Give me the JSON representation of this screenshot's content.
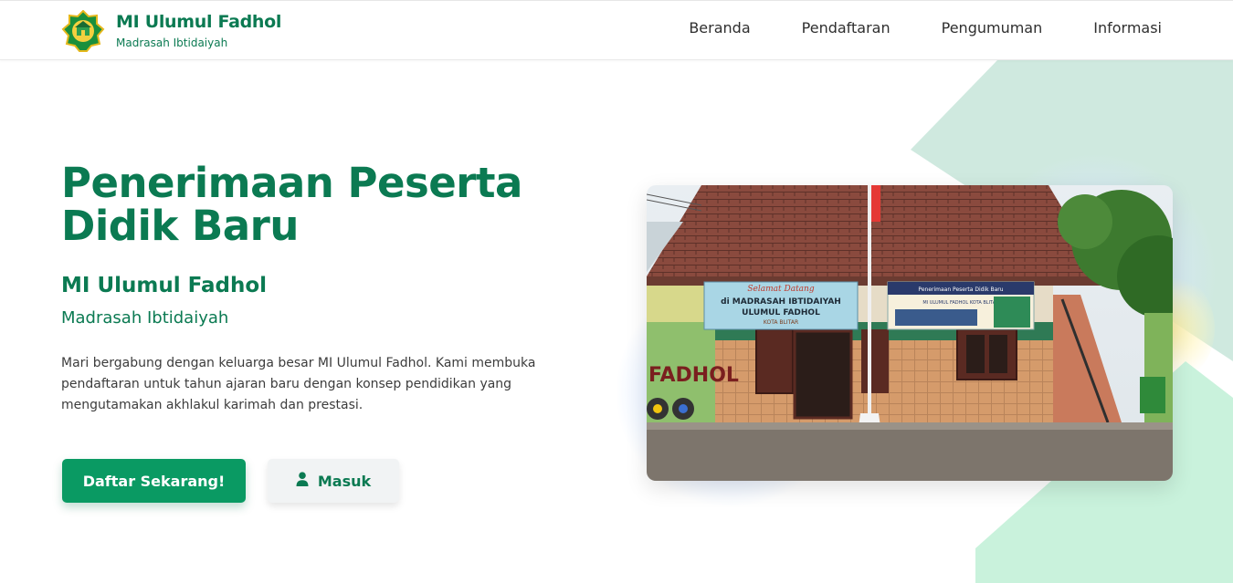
{
  "header": {
    "brand_name": "MI Ulumul Fadhol",
    "brand_sub": "Madrasah Ibtidaiyah",
    "logo_icon": "school-emblem-icon",
    "nav": [
      {
        "label": "Beranda"
      },
      {
        "label": "Pendaftaran"
      },
      {
        "label": "Pengumuman"
      },
      {
        "label": "Informasi"
      }
    ]
  },
  "hero": {
    "title_line1": "Penerimaan Peserta",
    "title_line2": "Didik Baru",
    "school_name": "MI Ulumul Fadhol",
    "school_type": "Madrasah Ibtidaiyah",
    "description": "Mari bergabung dengan keluarga besar MI Ulumul Fadhol. Kami membuka pendaftaran untuk tahun ajaran baru dengan konsep pendidikan yang mengutamakan akhlakul karimah dan prestasi.",
    "primary_button": "Daftar Sekarang!",
    "secondary_button": "Masuk",
    "secondary_icon": "user-icon"
  },
  "photo": {
    "banner_left_line1": "Selamat Datang",
    "banner_left_line2": "di MADRASAH IBTIDAIYAH",
    "banner_left_line3": "ULUMUL FADHOL",
    "banner_left_line4": "KOTA BLITAR",
    "banner_right_line1": "Penerimaan Peserta Didik Baru",
    "banner_right_line2": "MI ULUMUL FADHOL KOTA BLITAR",
    "wall_text": "FADHOL"
  },
  "colors": {
    "brand_green": "#0b7a52",
    "button_green": "#0a9a63",
    "decor_green": "#cfe9df",
    "decor_mint": "#c9f2dc"
  }
}
